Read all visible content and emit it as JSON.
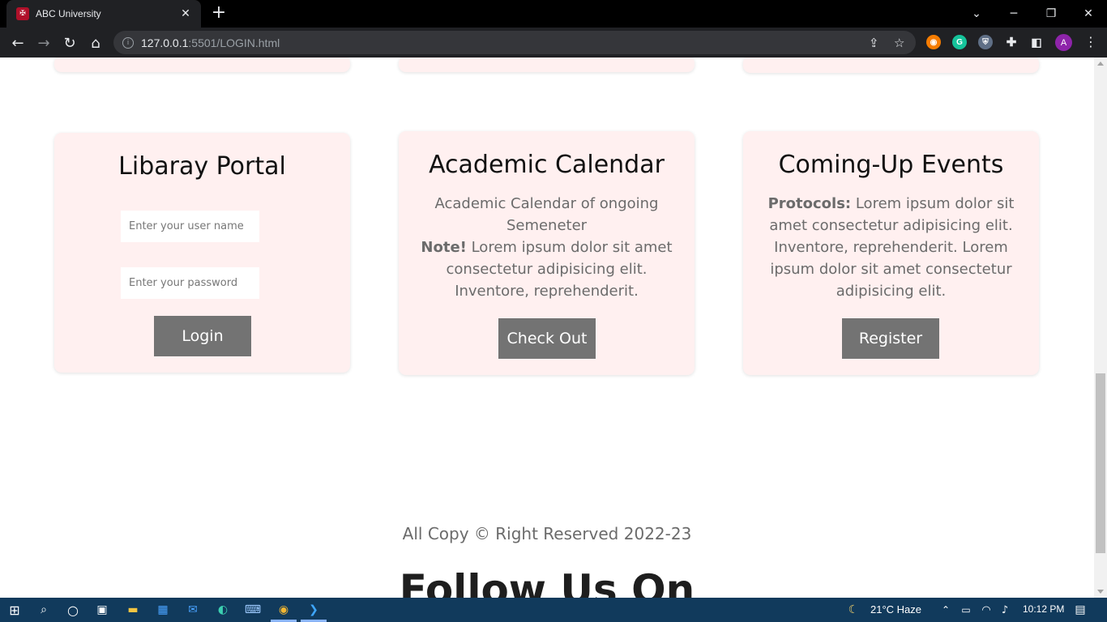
{
  "browser": {
    "tab_title": "ABC University",
    "url_host": "127.0.0.1",
    "url_rest": ":5501/LOGIN.html",
    "favicon_text": "✠",
    "profile_initial": "A",
    "icons": [
      "back-arrow",
      "forward-arrow",
      "reload",
      "home",
      "site-info",
      "share",
      "bookmark-star",
      "extensions",
      "side-panel",
      "menu-kebab"
    ],
    "extensions": [
      "rss-extension",
      "grammarly-extension",
      "shield-extension"
    ]
  },
  "cards": {
    "library": {
      "title": "Libaray Portal",
      "username_placeholder": "Enter your user name",
      "password_placeholder": "Enter your password",
      "button": "Login"
    },
    "calendar": {
      "title": "Academic Calendar",
      "line1": "Academic Calendar of ongoing Semeneter",
      "note_label": "Note!",
      "note_text": " Lorem ipsum dolor sit amet consectetur adipisicing elit. Inventore, reprehenderit.",
      "button": "Check Out"
    },
    "events": {
      "title": "Coming-Up Events",
      "protocols_label": "Protocols:",
      "protocols_text": " Lorem ipsum dolor sit amet consectetur adipisicing elit. Inventore, reprehenderit. Lorem ipsum dolor sit amet consectetur adipisicing elit.",
      "button": "Register"
    }
  },
  "footer": {
    "copyright": "All Copy © Right Reserved 2022-23",
    "follow_heading": "Follow Us On"
  },
  "colors": {
    "card_bg": "#fff0f0",
    "button_bg": "#737373",
    "taskbar_bg": "#113a5c",
    "chrome_bg": "#202124"
  },
  "taskbar": {
    "weather": "21°C  Haze",
    "time": "10:12 PM",
    "apps": [
      "windows-start",
      "search",
      "cortana",
      "task-view",
      "file-explorer",
      "microsoft-store",
      "mail",
      "edge",
      "keyboard-app",
      "chrome",
      "vscode"
    ]
  }
}
